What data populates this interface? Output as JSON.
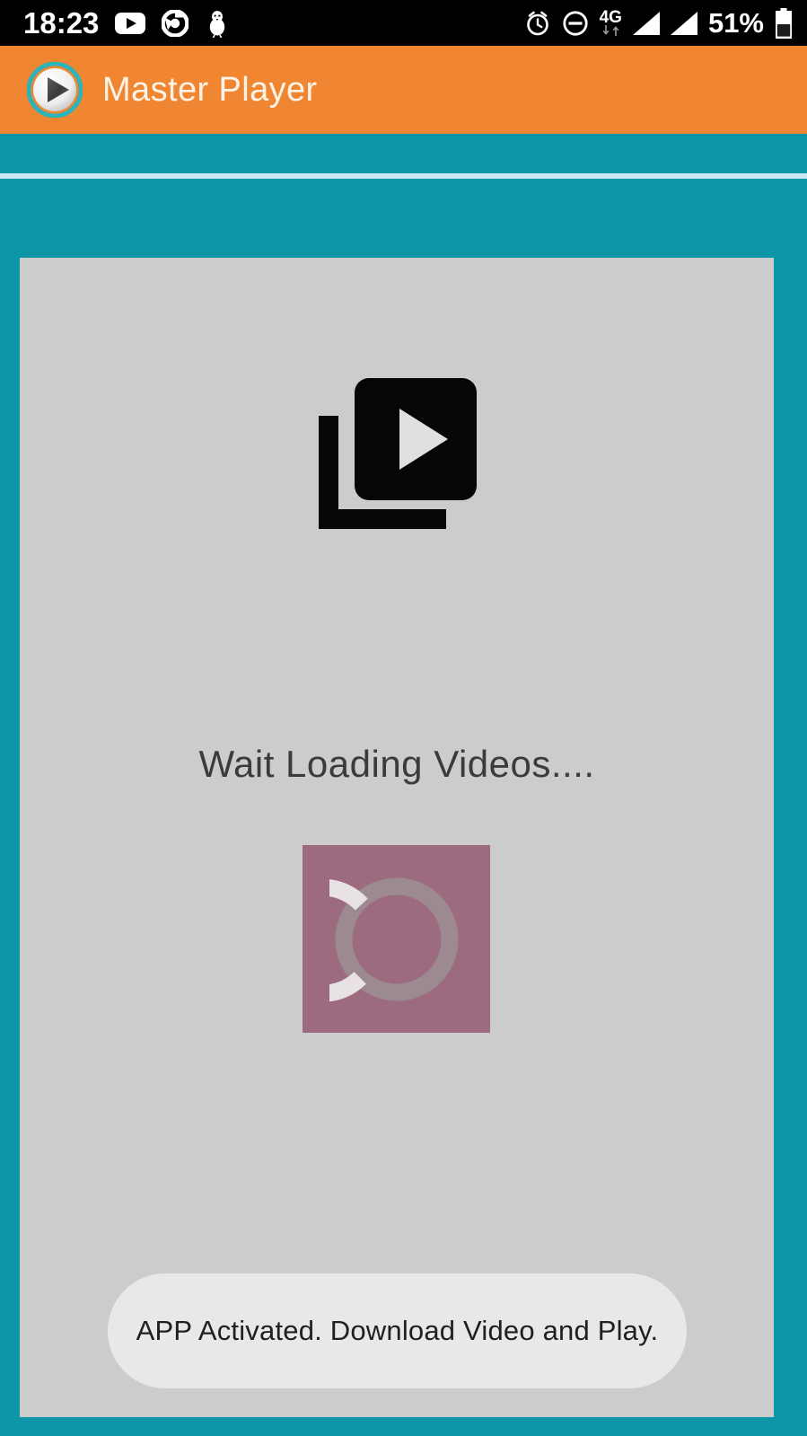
{
  "status_bar": {
    "time": "18:23",
    "battery_percent": "51%",
    "network_label": "4G",
    "left_icons": [
      "youtube-icon",
      "chrome-icon",
      "bird-icon"
    ],
    "right_icons": [
      "alarm-icon",
      "do-not-disturb-icon",
      "4g-data-icon",
      "signal-bars-icon-1",
      "signal-bars-icon-2",
      "battery-icon"
    ],
    "colors": {
      "background": "#000000",
      "foreground": "#ffffff"
    }
  },
  "app_bar": {
    "title": "Master Player",
    "logo_icon": "play-circle-logo",
    "colors": {
      "background": "#f08632",
      "title": "#fdf3e7"
    }
  },
  "background": {
    "colors": {
      "teal": "#0d95a8",
      "divider": "#c8e9ef"
    }
  },
  "content": {
    "video_icon": "video-library-icon",
    "loading_text": "Wait Loading Videos....",
    "spinner": {
      "name": "loading-spinner",
      "box_color": "#9d6b7f",
      "ring_color": "#e6e0e2",
      "ring_track_color": "#9c8a90"
    },
    "colors": {
      "card": "#cccccc",
      "loading_text": "#3b3b3b"
    }
  },
  "toast": {
    "message": "APP Activated. Download Video and Play.",
    "colors": {
      "background": "#e8e8e8",
      "text": "#202020"
    }
  }
}
